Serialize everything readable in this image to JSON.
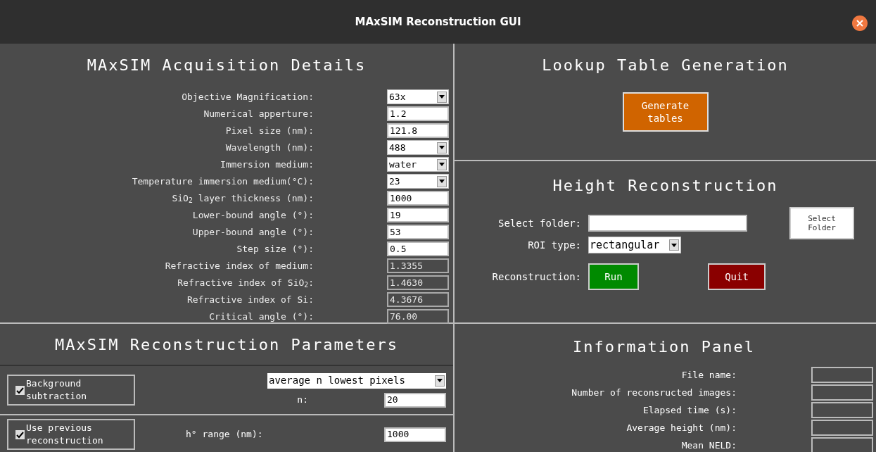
{
  "window": {
    "title": "MAxSIM Reconstruction GUI"
  },
  "acquisition": {
    "title": "MAxSIM Acquisition Details",
    "rows": [
      {
        "label": "Objective Magnification:",
        "kind": "dropdown",
        "value": "63x"
      },
      {
        "label": "Numerical apperture:",
        "kind": "input",
        "value": "1.2"
      },
      {
        "label": "Pixel size (nm):",
        "kind": "input",
        "value": "121.8"
      },
      {
        "label": "Wavelength (nm):",
        "kind": "dropdown",
        "value": "488"
      },
      {
        "label": "Immersion medium:",
        "kind": "dropdown",
        "value": "water"
      },
      {
        "label": "Temperature immersion medium(°C):",
        "kind": "dropdown",
        "value": "23"
      },
      {
        "label": "SiO$_{2}$ layer thickness (nm):",
        "kind": "input",
        "value": "1000"
      },
      {
        "label": "Lower-bound angle (°):",
        "kind": "input",
        "value": "19"
      },
      {
        "label": "Upper-bound angle (°):",
        "kind": "input",
        "value": "53"
      },
      {
        "label": "Step size (°):",
        "kind": "input",
        "value": "0.5"
      },
      {
        "label": "Refractive index of medium:",
        "kind": "readonly",
        "value": "1.3355"
      },
      {
        "label": "Refractive index of SiO$_{2}$:",
        "kind": "readonly",
        "value": "1.4630"
      },
      {
        "label": "Refractive index of Si:",
        "kind": "readonly",
        "value": "4.3676"
      },
      {
        "label": "Critical angle (°):",
        "kind": "readonly",
        "value": "76.00"
      }
    ]
  },
  "lookup": {
    "title": "Lookup Table Generation",
    "button": "Generate tables"
  },
  "height": {
    "title": "Height Reconstruction",
    "folder_label": "Select folder:",
    "folder_button": "Select Folder",
    "roi_label": "ROI type:",
    "roi_value": "rectangular",
    "reconstruction_label": "Reconstruction:",
    "run_button": "Run",
    "quit_button": "Quit"
  },
  "parameters": {
    "title": "MAxSIM Reconstruction Parameters",
    "background": {
      "label": "Background subtraction",
      "checked": true,
      "method": "average n lowest pixels",
      "n_label": "n:",
      "n_value": "20"
    },
    "previous": {
      "label": "Use previous reconstruction",
      "checked": true,
      "range_label": "h° range (nm):",
      "range_value": "1000"
    }
  },
  "info": {
    "title": "Information Panel",
    "rows": [
      {
        "label": "File name:"
      },
      {
        "label": "Number of reconsructed images:"
      },
      {
        "label": "Elapsed time (s):"
      },
      {
        "label": "Average height (nm):"
      },
      {
        "label": "Mean NELD:"
      }
    ]
  }
}
